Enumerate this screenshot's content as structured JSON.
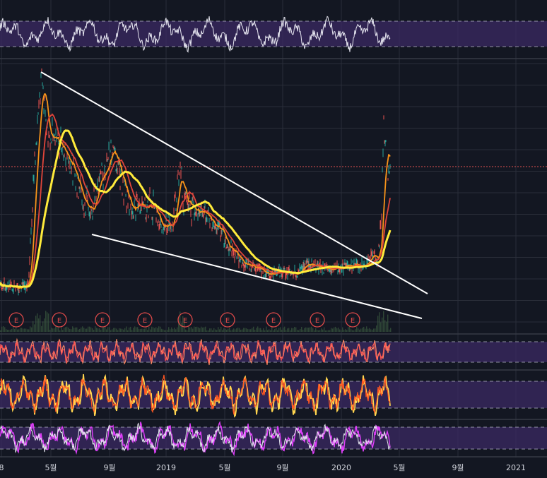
{
  "chart_data": {
    "type": "line",
    "x_axis": {
      "tick_labels": [
        "8",
        "5월",
        "9월",
        "2019",
        "5월",
        "9월",
        "2020",
        "5월",
        "9월",
        "2021"
      ]
    },
    "earnings_markers": {
      "label": "E",
      "count": 9
    },
    "main_panel": {
      "price_line_color": "#26a69a",
      "moving_averages": [
        {
          "color": "#f7931a",
          "role": "fast"
        },
        {
          "color": "#e0453a",
          "role": "medium"
        },
        {
          "color": "#ffeb3b",
          "role": "slow"
        }
      ],
      "reference_line": {
        "color": "#e05050",
        "style": "dotted",
        "level": "current"
      },
      "trend_lines": [
        {
          "name": "upper wedge",
          "color": "#ffffff"
        },
        {
          "name": "lower wedge",
          "color": "#ffffff"
        }
      ]
    },
    "oscillators": [
      {
        "panel": "rsi",
        "line_colors": [
          "#e6e6f0"
        ],
        "band": "#3b2a63"
      },
      {
        "panel": "osc1",
        "line_colors": [
          "#ff8a65",
          "#ff5252"
        ],
        "band": "#3b2a63"
      },
      {
        "panel": "osc2",
        "line_colors": [
          "#ffd54f",
          "#ff5722"
        ],
        "band": "#3b2a63"
      },
      {
        "panel": "osc3",
        "line_colors": [
          "#e040fb",
          "#e6e6f0"
        ],
        "band": "#3b2a63"
      }
    ],
    "grid": true,
    "colors": {
      "background": "#131722",
      "grid": "#2a2e39",
      "band": "#3b2a63",
      "axis_text": "#d1d4dc"
    }
  }
}
